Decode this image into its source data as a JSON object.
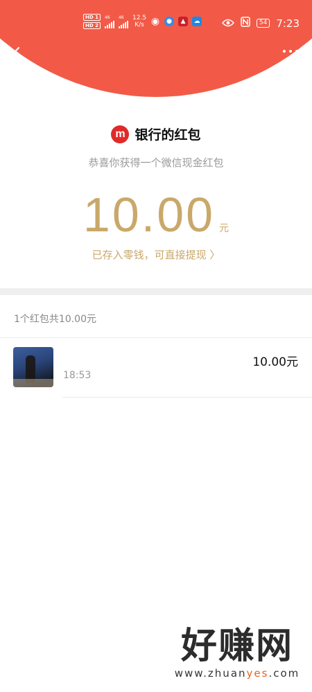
{
  "status_bar": {
    "hd1": "HD 1",
    "hd2": "HD 2",
    "net1": "46",
    "net2": "46",
    "speed_value": "12.5",
    "speed_unit": "K/s",
    "battery": "54",
    "time": "7:23"
  },
  "header": {
    "bg_color": "#f25a47"
  },
  "brand": {
    "logo_text": "m",
    "name": "银行的红包"
  },
  "subtitle": "恭喜你获得一个微信现金红包",
  "amount": {
    "value": "10.00",
    "unit": "元",
    "color": "#c9a86a"
  },
  "withdraw_link": "已存入零钱，可直接提现 〉",
  "summary": "1个红包共10.00元",
  "records": [
    {
      "time": "18:53",
      "amount": "10.00元"
    }
  ],
  "watermark": {
    "main": "好赚网",
    "sub_prefix": "www.zhuan",
    "sub_highlight": "yes",
    "sub_suffix": ".com"
  }
}
